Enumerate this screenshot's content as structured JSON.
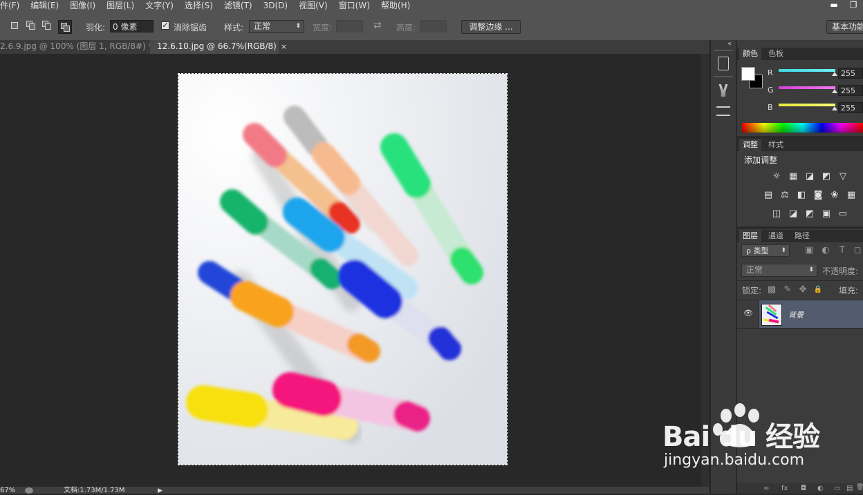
{
  "menubar": {
    "items": [
      "件(F)",
      "编辑(E)",
      "图像(I)",
      "图层(L)",
      "文字(Y)",
      "选择(S)",
      "滤镜(T)",
      "3D(D)",
      "视图(V)",
      "窗口(W)",
      "帮助(H)"
    ],
    "minimize": "▬",
    "restore": "❐"
  },
  "options": {
    "feather_label": "羽化:",
    "feather_value": "0 像素",
    "antialias_label": "消除锯齿",
    "antialias_checked": "✓",
    "style_label": "样式:",
    "style_value": "正常",
    "width_label": "宽度:",
    "height_label": "高度:",
    "swap_icon": "⇄",
    "refine_edge": "调整边缘 ...",
    "workspace": "基本功能"
  },
  "tabs": [
    {
      "label": "2.6.9.jpg @ 100% (图层 1, RGB/8#) *",
      "close": "×"
    },
    {
      "label": "12.6.10.jpg @ 66.7%(RGB/8)",
      "close": "×"
    }
  ],
  "status": {
    "zoom": "67%",
    "doc_info": "文档:1.73M/1.73M",
    "arrow": "▶"
  },
  "color_panel": {
    "tabs": [
      "颜色",
      "色板"
    ],
    "channels": [
      {
        "label": "R",
        "value": "255",
        "color": "#4de0e6"
      },
      {
        "label": "G",
        "value": "255",
        "color": "#e04de0"
      },
      {
        "label": "B",
        "value": "255",
        "color": "#f0f04d"
      }
    ],
    "collapse": "«"
  },
  "adjust_panel": {
    "tabs": [
      "调整",
      "样式"
    ],
    "title": "添加调整",
    "rows": [
      [
        "☼",
        "▦",
        "◪",
        "◩",
        "▽"
      ],
      [
        "▤",
        "⚖",
        "◧",
        "◙",
        "❀",
        "▦"
      ],
      [
        "◫",
        "◪",
        "◩",
        "▣",
        "▭"
      ]
    ]
  },
  "layers_panel": {
    "tabs": [
      "图层",
      "通道",
      "路径"
    ],
    "filter_label": "ρ 类型",
    "filter_icons": [
      "▣",
      "◐",
      "T",
      "◻"
    ],
    "blend_mode": "正常",
    "opacity_label": "不透明度:",
    "lock_label": "锁定:",
    "lock_icons": [
      "▩",
      "✎",
      "✥",
      "🔒"
    ],
    "fill_label": "填充:",
    "layer_name": "背景",
    "eye": "👁",
    "bottom_icons": [
      "∞",
      "fx",
      "◘",
      "◐",
      "▭",
      "▤",
      "🗑"
    ]
  },
  "watermark": {
    "brand": "Bai du 经验",
    "url": "jingyan.baidu.com"
  }
}
